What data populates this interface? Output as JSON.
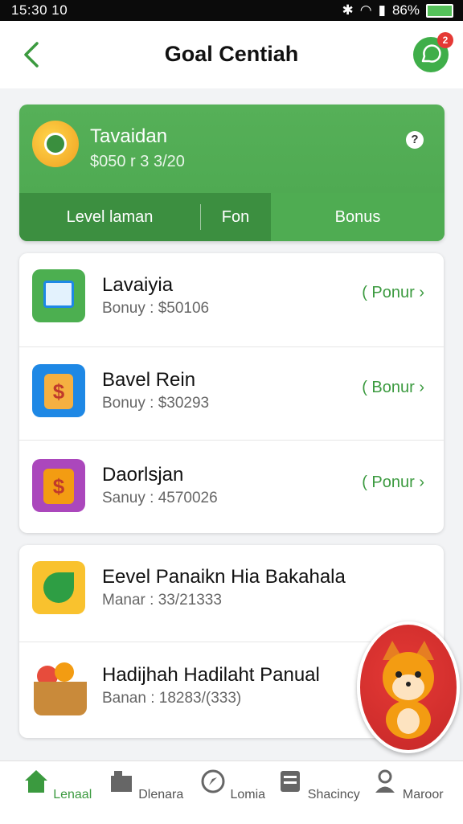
{
  "status": {
    "time": "15:30 10",
    "battery": "86%"
  },
  "header": {
    "title": "Goal Centiah",
    "chat_badge": "2"
  },
  "hero": {
    "name": "Tavaidan",
    "amount": "$050 r 3 3/20",
    "help": "?",
    "tabs": [
      {
        "label": "Level laman"
      },
      {
        "label": "Fon"
      },
      {
        "label": "Bonus"
      }
    ]
  },
  "list_a": [
    {
      "title": "Lavaiyia",
      "subtitle": "Bonuy : $50106",
      "action": "( Ponur ›"
    },
    {
      "title": "Bavel Rein",
      "subtitle": "Bonuy : $30293",
      "action": "( Bonur ›"
    },
    {
      "title": "Daorlsjan",
      "subtitle": "Sanuy : 4570026",
      "action": "( Ponur ›"
    }
  ],
  "list_b": [
    {
      "title": "Eevel Panaikn Hia Bakahala",
      "subtitle": "Manar : 33/21333"
    },
    {
      "title": "Hadijhah Hadilaht Panual",
      "subtitle": "Banan : 18283/(333)"
    }
  ],
  "bottom_nav": [
    {
      "label": "Lenaal"
    },
    {
      "label": "Dlenara"
    },
    {
      "label": "Lomia"
    },
    {
      "label": "Shacincy"
    },
    {
      "label": "Maroor"
    }
  ],
  "colors": {
    "accent": "#3b9a3f",
    "hero": "#4fac52",
    "badge": "#e53935"
  }
}
